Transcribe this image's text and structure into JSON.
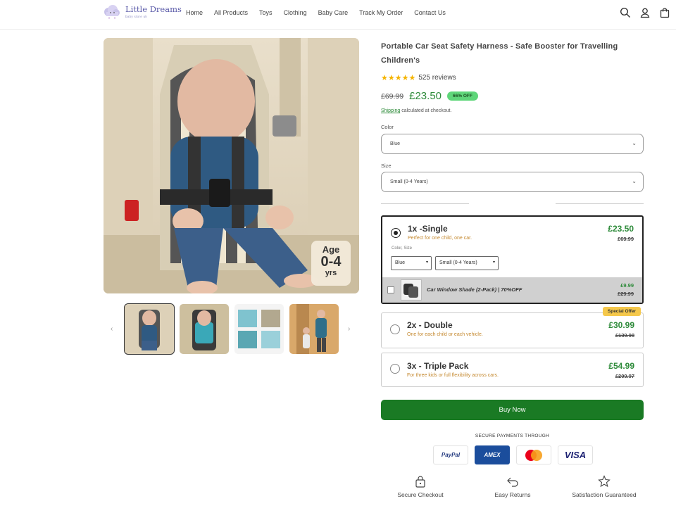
{
  "header": {
    "brand": "Little Dreams",
    "brand_sub": "baby store uk",
    "nav": [
      "Home",
      "All Products",
      "Toys",
      "Clothing",
      "Baby Care",
      "Track My Order",
      "Contact Us"
    ]
  },
  "gallery": {
    "badge": {
      "line1": "Age",
      "line2": "0-4",
      "line3": "yrs"
    },
    "thumbnail_count": 4,
    "selected_thumbnail": 1
  },
  "product": {
    "title": "Portable Car Seat Safety Harness - Safe Booster for Travelling Children's",
    "stars": "★★★★★",
    "reviews": "525 reviews",
    "old_price": "£69.99",
    "price": "£23.50",
    "discount_badge": "66% OFF",
    "shipping_link": "Shipping",
    "shipping_text": " calculated at checkout.",
    "color_label": "Color",
    "color_value": "Blue",
    "size_label": "Size",
    "size_value": "Small (0-4 Years)"
  },
  "bundles": [
    {
      "title": "1x -Single",
      "subtitle": "Perfect for one child, one car.",
      "price": "£23.50",
      "old_price": "£69.99",
      "selected": true,
      "options_label": "Color, Size",
      "color": "Blue",
      "size": "Small (0-4 Years)"
    },
    {
      "title": "2x - Double",
      "subtitle": "One for each child or each vehicle.",
      "price": "£30.99",
      "old_price": "£139.98",
      "badge": "Special Offer"
    },
    {
      "title": "3x - Triple Pack",
      "subtitle": "For three kids or full flexibility across cars.",
      "price": "£54.99",
      "old_price": "£209.97"
    }
  ],
  "upsell": {
    "title": "Car Window Shade (2-Pack) | 70%OFF",
    "price": "£9.99",
    "old_price": "£29.99"
  },
  "buy_label": "Buy Now",
  "payments": {
    "label": "SECURE PAYMENTS THROUGH",
    "methods": [
      "PayPal",
      "AMEX",
      "Mastercard",
      "VISA"
    ]
  },
  "trust": [
    "Secure Checkout",
    "Easy Returns",
    "Satisfaction Guaranteed"
  ],
  "colors": {
    "accent_green": "#2e8b3a",
    "buy_button": "#1a7a24",
    "badge_green": "#5fd67a",
    "special_offer": "#f5c84b",
    "stars": "#f5b400"
  }
}
